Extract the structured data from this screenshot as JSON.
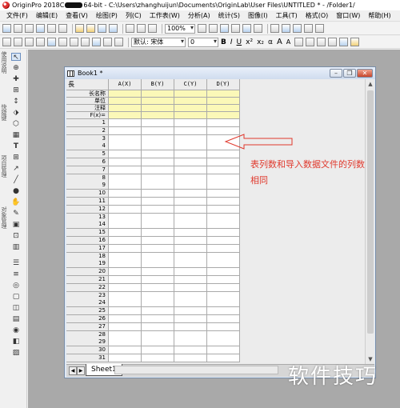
{
  "window": {
    "title_prefix": "OriginPro 2018C",
    "title_suffix": "64-bit - C:\\Users\\zhanghuijun\\Documents\\OriginLab\\User Files\\UNTITLED * - /Folder1/"
  },
  "menu": [
    "文件(F)",
    "编辑(E)",
    "查看(V)",
    "绘图(P)",
    "列(C)",
    "工作表(W)",
    "分析(A)",
    "统计(S)",
    "图像(I)",
    "工具(T)",
    "格式(O)",
    "窗口(W)",
    "帮助(H)"
  ],
  "toolbar": {
    "zoom": "100%",
    "font_name": "默认: 宋体",
    "font_size": "0",
    "format_buttons": [
      "B",
      "I",
      "U",
      "x²",
      "x₂",
      "α",
      "A",
      "A"
    ]
  },
  "book": {
    "title": "Book1 *",
    "corner_label": "長",
    "columns": [
      "A(X)",
      "B(Y)",
      "C(Y)",
      "D(Y)"
    ],
    "meta_rows": [
      "长名称",
      "单位",
      "注释",
      "F(x)="
    ],
    "row_numbers": [
      "1",
      "2",
      "3",
      "4",
      "5",
      "6",
      "7",
      "8",
      "9",
      "10",
      "11",
      "12",
      "13",
      "14",
      "15",
      "16",
      "17",
      "18",
      "19",
      "20",
      "21",
      "22",
      "23",
      "24",
      "25",
      "26",
      "27",
      "28",
      "29",
      "30",
      "31"
    ],
    "sheet_tab": "Sheet1"
  },
  "annotation": {
    "text": "表列数和导入数据文件的列数相同",
    "color": "#e0392d"
  },
  "left_toolbar_labels": [
    "使用说明",
    "快捷键",
    "项目管理",
    "对象管理"
  ],
  "watermark": "软件技巧",
  "colors": {
    "meta_row_bg": "#fbf8b8",
    "workspace_bg": "#a9a9a9",
    "annotation": "#e0392d"
  }
}
